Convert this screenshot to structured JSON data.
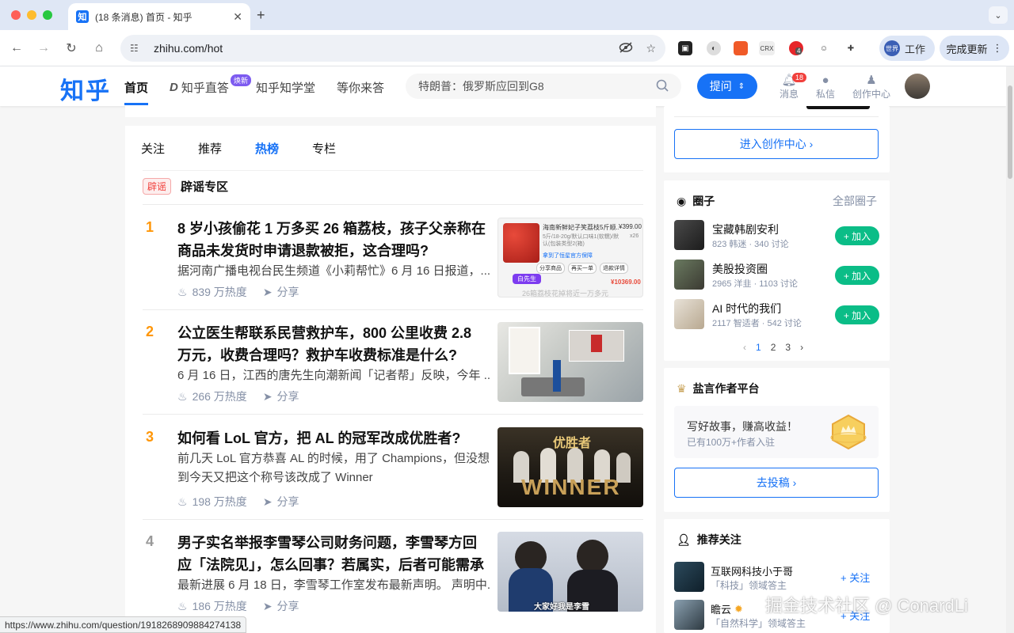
{
  "browser": {
    "tab_title": "(18 条消息) 首页 - 知乎",
    "tab_favicon": "知",
    "tab_close": "✕",
    "new_tab": "+",
    "url": "zhihu.com/hot",
    "ext_crx": "CRX",
    "ext_count": "4",
    "profile_label": "工作",
    "profile_avatar": "世界",
    "update_label": "完成更新",
    "status_url": "https://www.zhihu.com/question/1918268909884274138",
    "colors": {
      "tabbar": "#dfe7f5",
      "accent": "#1772f6"
    }
  },
  "header": {
    "logo": "知乎",
    "nav": {
      "home": "首页",
      "live": "知乎直答",
      "live_badge": "焕新",
      "knowledge": "知乎知学堂",
      "answer": "等你来答"
    },
    "search_placeholder": "特朗普：俄罗斯应回到G8",
    "ask_button": "提问",
    "messages_label": "消息",
    "messages_count": "18",
    "dm_label": "私信",
    "creator_label": "创作中心"
  },
  "main": {
    "tabs": [
      "关注",
      "推荐",
      "热榜",
      "专栏"
    ],
    "rumor_tag": "辟谣",
    "rumor_title": "辟谣专区",
    "hot_list": [
      {
        "rank": "1",
        "title": "8 岁小孩偷花 1 万多买 26 箱荔枝，孩子父亲称在商品未发货时申请退款被拒，这合理吗?",
        "excerpt": "据河南广播电视台民生频道《小莉帮忙》6 月 16 日报道，...",
        "heat": "839 万热度",
        "share": "分享",
        "thumb_text": {
          "product": "海南新鲜妃子笑荔枝5斤顺...",
          "price": "¥399.00",
          "spec": "5斤/18-20g/默认口味1(软糯)/默认(包装类型2(箱)",
          "qty": "x26",
          "seller": "白先生",
          "total": "¥10369.00",
          "promo": "拿到了恒星官方保障",
          "btn1": "分享商品",
          "btn2": "再买一单",
          "btn3": "退款详情",
          "caption": "26箱荔枝花掉将近一万多元"
        }
      },
      {
        "rank": "2",
        "title": "公立医生帮联系民营救护车，800 公里收费 2.8 万元，收费合理吗？救护车收费标准是什么?",
        "excerpt": "6 月 16 日，江西的唐先生向潮新闻「记者帮」反映，今年 ...",
        "heat": "266 万热度",
        "share": "分享"
      },
      {
        "rank": "3",
        "title": "如何看 LoL 官方，把 AL 的冠军改成优胜者?",
        "excerpt": "前几天 LoL 官方恭喜 AL 的时候，用了 Champions，但没想到今天又把这个称号该改成了 Winner",
        "heat": "198 万热度",
        "share": "分享",
        "thumb_text": {
          "top": "优胜者",
          "bottom": "WINNER"
        }
      },
      {
        "rank": "4",
        "title": "男子实名举报李雪琴公司财务问题，李雪琴方回应「法院见」，怎么回事？若属实，后者可能需承担...",
        "excerpt": "最新进展 6 月 18 日，李雪琴工作室发布最新声明。 声明中...",
        "heat": "186 万热度",
        "share": "分享",
        "thumb_text": {
          "caption": "大家好我是李雪"
        }
      }
    ]
  },
  "sidebar": {
    "creator_center_button": "进入创作中心 ›",
    "circles": {
      "title": "圈子",
      "more": "全部圈子",
      "items": [
        {
          "name": "宝藏韩剧安利",
          "stats": "823 韩迷 · 340 讨论",
          "join": "+ 加入"
        },
        {
          "name": "美股投资圈",
          "stats": "2965 洋韭 · 1103 讨论",
          "join": "+ 加入"
        },
        {
          "name": "AI 时代的我们",
          "stats": "2117 智适者 · 542 讨论",
          "join": "+ 加入"
        }
      ],
      "pager": {
        "prev": "‹",
        "pages": [
          "1",
          "2",
          "3"
        ],
        "next": "›"
      }
    },
    "yanxuan": {
      "title": "盐言作者平台",
      "promo_title": "写好故事，赚高收益！",
      "promo_sub": "已有100万+作者入驻",
      "submit_button": "去投稿 ›"
    },
    "recommend": {
      "title": "推荐关注",
      "items": [
        {
          "name": "互联网科技小于哥",
          "desc": "「科技」领域答主",
          "follow": "+ 关注"
        },
        {
          "name": "瞻云",
          "desc": "「自然科学」领域答主",
          "follow": "+ 关注"
        }
      ]
    }
  },
  "watermark": "掘金技术社区 @ ConardLi"
}
